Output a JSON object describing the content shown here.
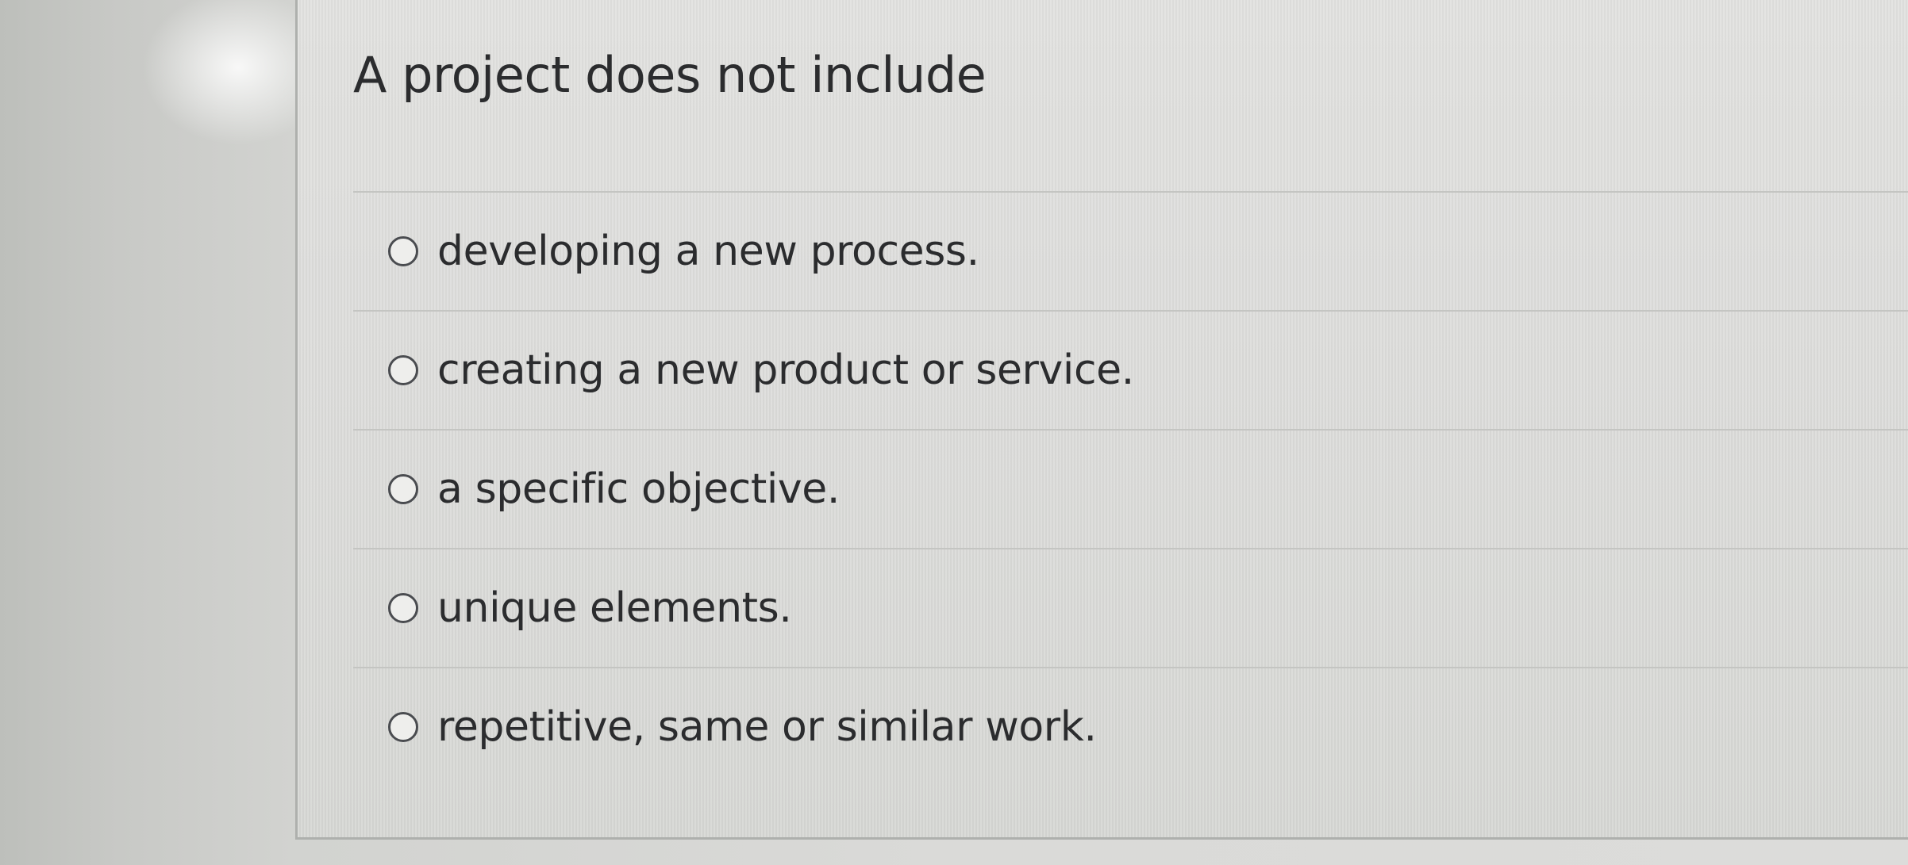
{
  "question": {
    "text": "A project does not include"
  },
  "answers": [
    {
      "label": "developing a new process.",
      "selected": false
    },
    {
      "label": "creating a new product or service.",
      "selected": false
    },
    {
      "label": "a specific objective.",
      "selected": false
    },
    {
      "label": "unique elements.",
      "selected": false
    },
    {
      "label": "repetitive, same or similar work.",
      "selected": false
    }
  ],
  "colors": {
    "text": "#2b2c2e",
    "radio_border": "#4a4c50",
    "divider": "#c4c5c2",
    "card_background": "#dcdcda"
  }
}
